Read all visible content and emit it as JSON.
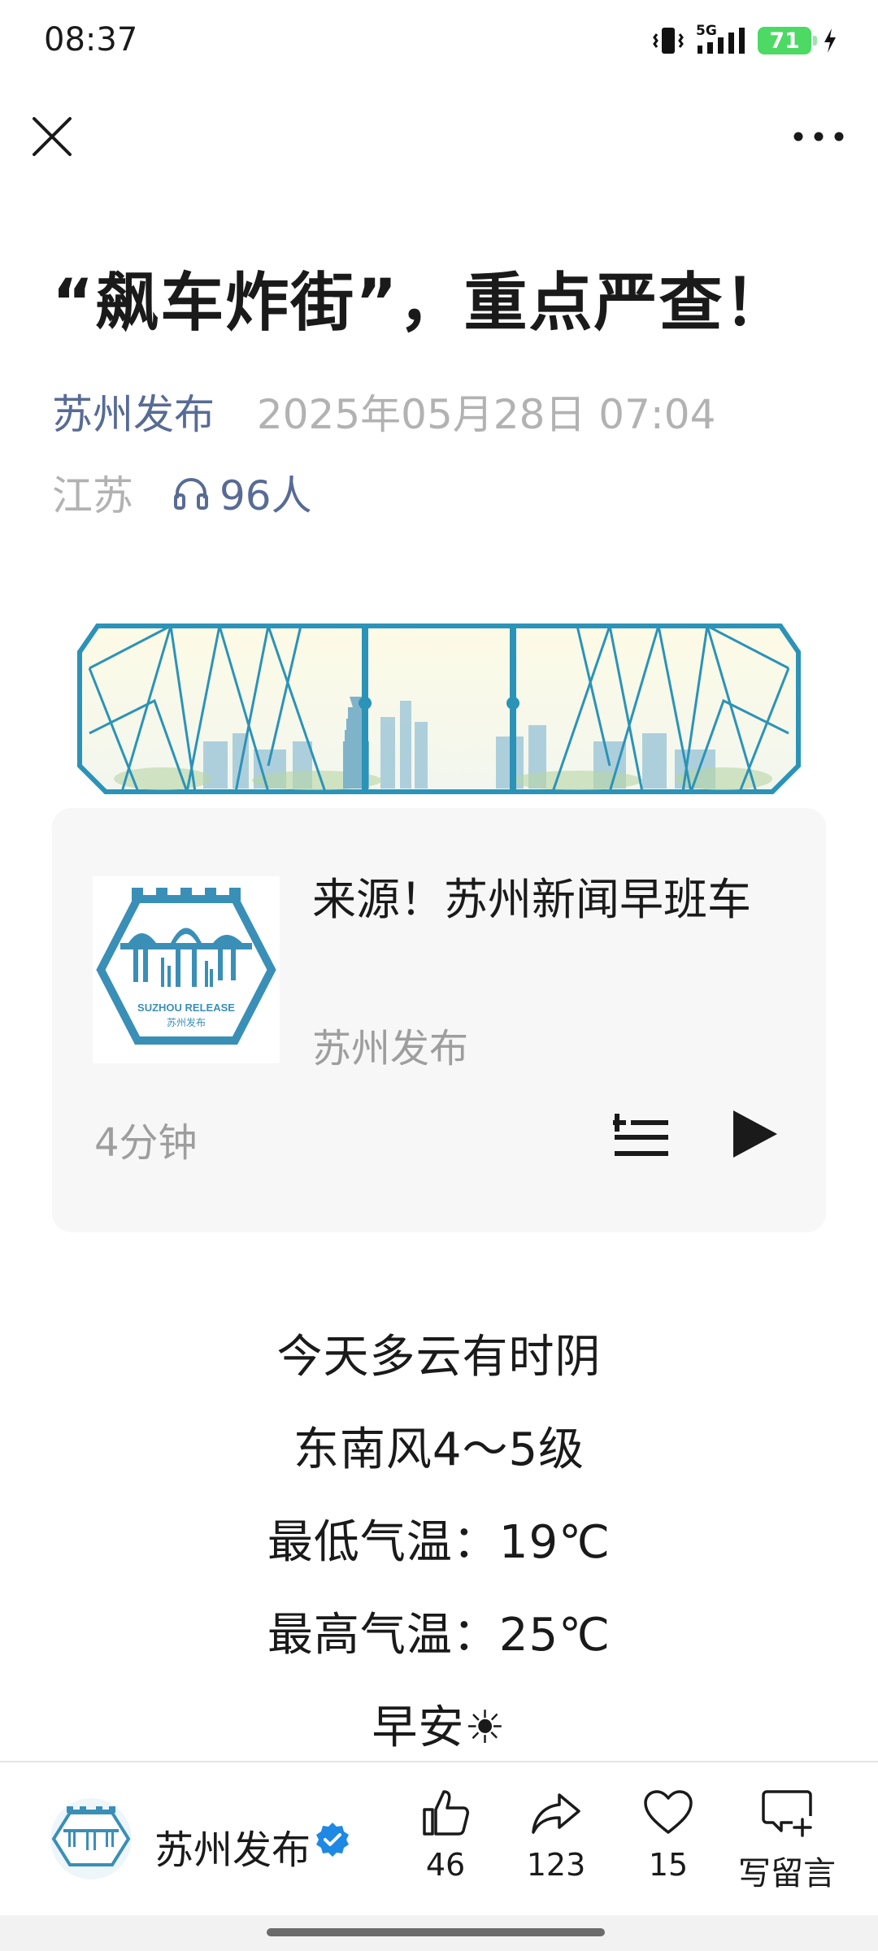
{
  "status_bar": {
    "time": "08:37",
    "network": "5G",
    "battery": "71"
  },
  "nav": {
    "close_icon": "close-icon",
    "more_icon": "more-dots-icon"
  },
  "article": {
    "title": "“飙车炸街”，重点严查！",
    "account": "苏州发布",
    "date": "2025年05月28日 07:04",
    "region": "江苏",
    "listeners": "96人"
  },
  "audio": {
    "title": "来源！苏州新闻早班车",
    "author": "苏州发布",
    "duration": "4分钟",
    "cover_text_en": "SUZHOU RELEASE",
    "cover_text_cn": "苏州发布"
  },
  "body": {
    "lines": [
      "今天多云有时阴",
      "东南风4～5级",
      "最低气温：19℃",
      "最高气温：25℃",
      "早安☀"
    ]
  },
  "bottom_bar": {
    "account_name": "苏州发布",
    "like_count": "46",
    "share_count": "123",
    "favorite_count": "15",
    "comment_label": "写留言"
  },
  "colors": {
    "link": "#576b95",
    "muted": "#b2b2b2",
    "brand_teal": "#2b93b8",
    "verified_blue": "#1e88e5"
  }
}
